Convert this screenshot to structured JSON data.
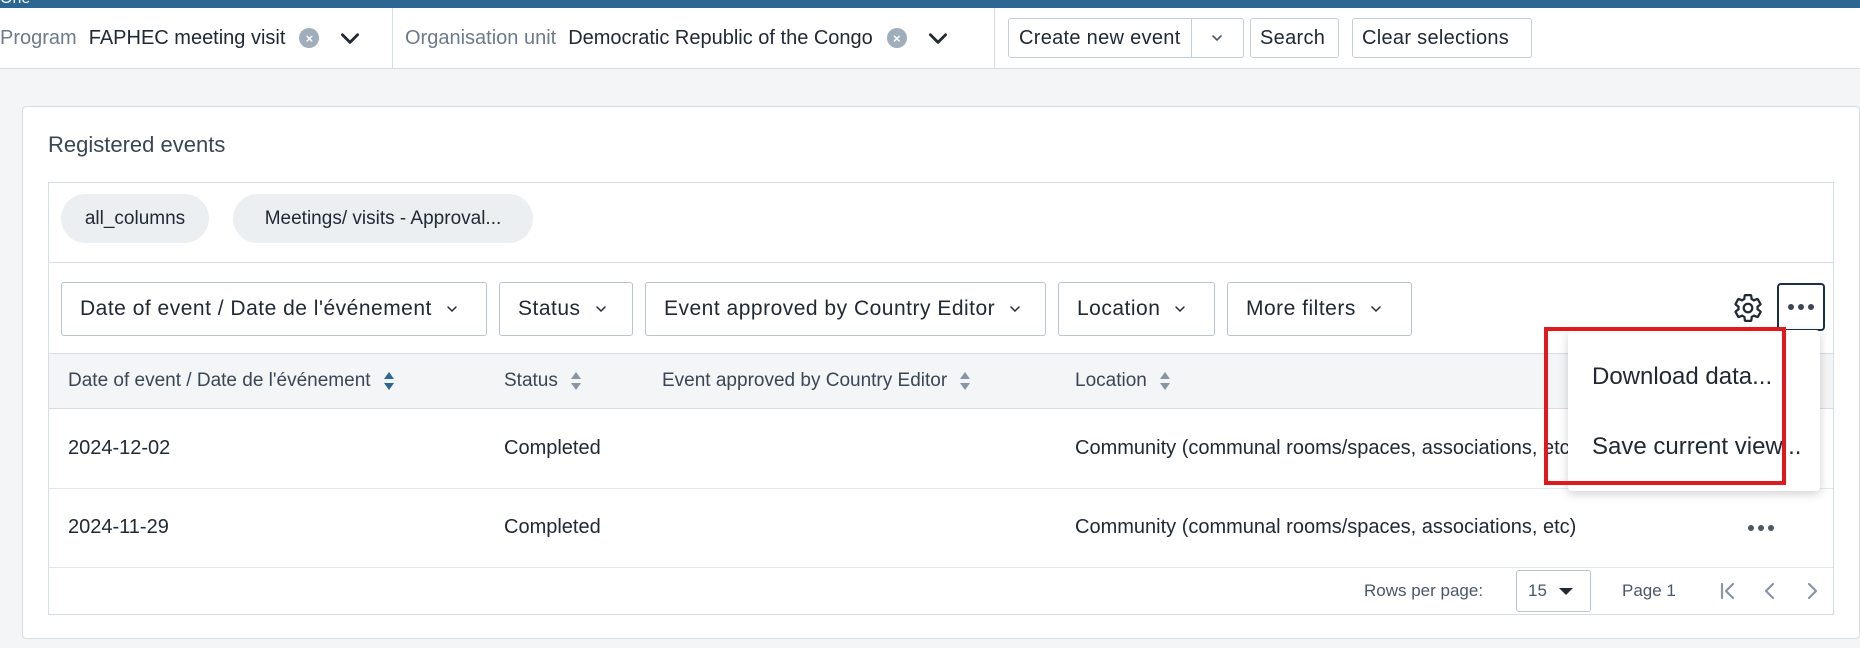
{
  "header": {
    "app_title": "One"
  },
  "selectors": {
    "program": {
      "label": "Program",
      "value": "FAPHEC meeting visit"
    },
    "org_unit": {
      "label": "Organisation unit",
      "value": "Democratic Republic of the Congo"
    }
  },
  "toolbar": {
    "create_label": "Create new event",
    "search_label": "Search",
    "clear_label": "Clear selections"
  },
  "panel": {
    "title": "Registered events"
  },
  "views": [
    {
      "label": "all_columns"
    },
    {
      "label": "Meetings/ visits - Approval..."
    }
  ],
  "filters": [
    {
      "label": "Date of event / Date de l'événement"
    },
    {
      "label": "Status"
    },
    {
      "label": "Event approved by Country Editor"
    },
    {
      "label": "Location"
    },
    {
      "label": "More filters"
    }
  ],
  "table": {
    "columns": [
      "Date of event / Date de l'événement",
      "Status",
      "Event approved by Country Editor",
      "Location"
    ],
    "sorted_column": "Date of event / Date de l'événement",
    "rows": [
      {
        "date": "2024-12-02",
        "status": "Completed",
        "approved": "",
        "location": "Community (communal rooms/spaces, associations, etc)"
      },
      {
        "date": "2024-11-29",
        "status": "Completed",
        "approved": "",
        "location": "Community (communal rooms/spaces, associations, etc)"
      }
    ]
  },
  "pagination": {
    "rows_label": "Rows per page:",
    "rows_value": "15",
    "page_label": "Page 1"
  },
  "menu": {
    "items": [
      {
        "label": "Download data..."
      },
      {
        "label": "Save current view..."
      }
    ]
  },
  "colors": {
    "header": "#2c6693",
    "highlight": "#e0191e",
    "sort_active": "#2c6693"
  }
}
